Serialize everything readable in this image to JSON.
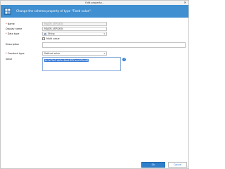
{
  "window": {
    "title": "Edit property...",
    "close_glyph": "✕"
  },
  "header": {
    "text": "Change the schema property of type \"Fixed value\".",
    "icon": "grid-app-icon"
  },
  "form": {
    "name": {
      "label": "Name",
      "required_mark": "*",
      "value": "MAJOR_VERSION"
    },
    "display_name": {
      "label": "Display name",
      "value": "MAJOR_VERSION"
    },
    "data_type": {
      "label": "Data type",
      "required_mark": "*",
      "value": "String"
    },
    "multi_value": {
      "label": "Multi value",
      "checked": false
    },
    "description": {
      "label": "Description",
      "value": ""
    },
    "constant_type": {
      "label": "Constant type",
      "required_mark": "*",
      "value": "Defined value"
    },
    "value": {
      "label": "Value",
      "text": "bc1a79a2-eb5e-4bed-8f3f-aca1f5bcd8"
    }
  },
  "buttons": {
    "ok": "Ok",
    "cancel": "Cancel"
  },
  "colors": {
    "header": "#3f8fd1",
    "ok": "#2f7fcb",
    "selection": "#3a7bd5",
    "required": "#d32f2f"
  }
}
